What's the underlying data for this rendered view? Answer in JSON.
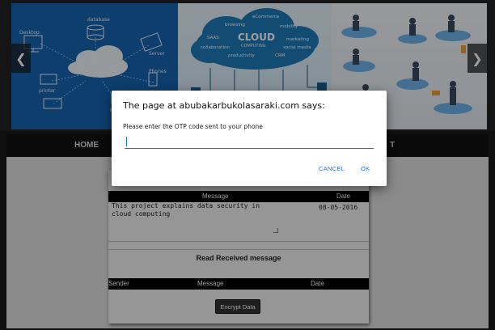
{
  "slider": {
    "prev_glyph": "❮",
    "next_glyph": "❯",
    "labels": {
      "desktop": "Desktop",
      "database": "database",
      "server": "Server",
      "phones": "Phones",
      "printer": "printer",
      "tablet": "tablet"
    },
    "cloud_words": {
      "ecommerce": "eCommerce",
      "browsing": "browsing",
      "mobility": "mobility",
      "cloud": "CLOUD",
      "computing": "COMPUTING",
      "saas": "SAAS",
      "collaboration": "collaboration",
      "marketing": "marketing",
      "social_media": "social media",
      "productivity": "productivity",
      "crm": "CRM"
    }
  },
  "nav": {
    "items": [
      "HOME",
      "T"
    ]
  },
  "messages": {
    "header": {
      "message": "Message",
      "date": "Date"
    },
    "sent_message_text": "This project explains data security in cloud computing",
    "sent_date": "08-05-2016",
    "received_title": "Read Received message",
    "received_header": {
      "sender": "Sender",
      "message": "Message",
      "date": "Date"
    },
    "encrypt_button": "Encrypt Data"
  },
  "dialog": {
    "title": "The page at abubakarbukolasaraki.com says:",
    "message": "Please enter the OTP code sent to your phone",
    "input_value": "",
    "cancel_label": "CANCEL",
    "ok_label": "OK"
  },
  "colors": {
    "accent": "#1e6fd0",
    "hero_blue": "#1565b0"
  }
}
